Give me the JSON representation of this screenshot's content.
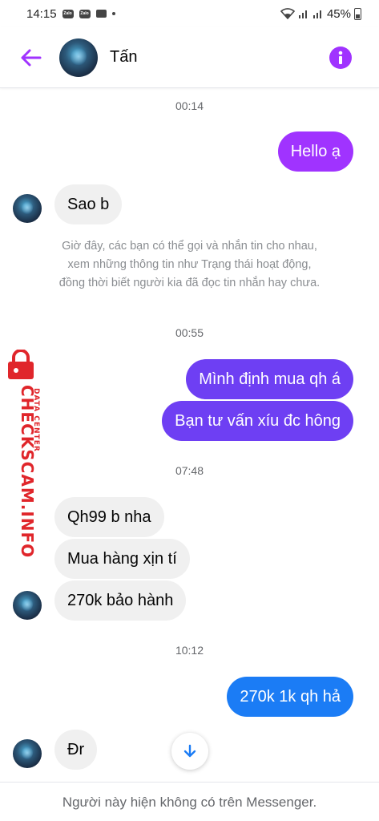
{
  "status_bar": {
    "time": "14:15",
    "notif_app_1": "Zalo",
    "notif_app_2": "Zalo",
    "battery": "45%"
  },
  "header": {
    "contact_name": "Tấn",
    "back_icon": "arrow-left-icon",
    "info_icon": "info-icon"
  },
  "conversation": {
    "time_1": "00:14",
    "msg_hello": "Hello ạ",
    "msg_sao_b": "Sao b",
    "notice": "Giờ đây, các bạn có thể gọi và nhắn tin cho nhau, xem những thông tin như Trạng thái hoạt động, đồng thời biết người kia đã đọc tin nhắn hay chưa.",
    "time_2": "00:55",
    "msg_mua_qh": "Mình định mua qh á",
    "msg_tu_van": "Bạn tư vấn xíu đc hông",
    "time_3": "07:48",
    "msg_qh99": "Qh99 b nha",
    "msg_mua_hang": "Mua hàng xịn tí",
    "msg_270k": "270k bảo hành",
    "time_4": "10:12",
    "msg_270k_1k": "270k 1k qh hả",
    "msg_dr": "Đr"
  },
  "watermark": {
    "main": "CHECKSCAM.INFO",
    "sub": "DATA CENTER"
  },
  "footer": {
    "text": "Người này hiện không có trên Messenger."
  },
  "colors": {
    "accent": "#a033ff",
    "violet": "#6e3ff3",
    "blue": "#1b7cf5",
    "incoming": "#f0f0f0",
    "watermark": "#e0262b"
  }
}
